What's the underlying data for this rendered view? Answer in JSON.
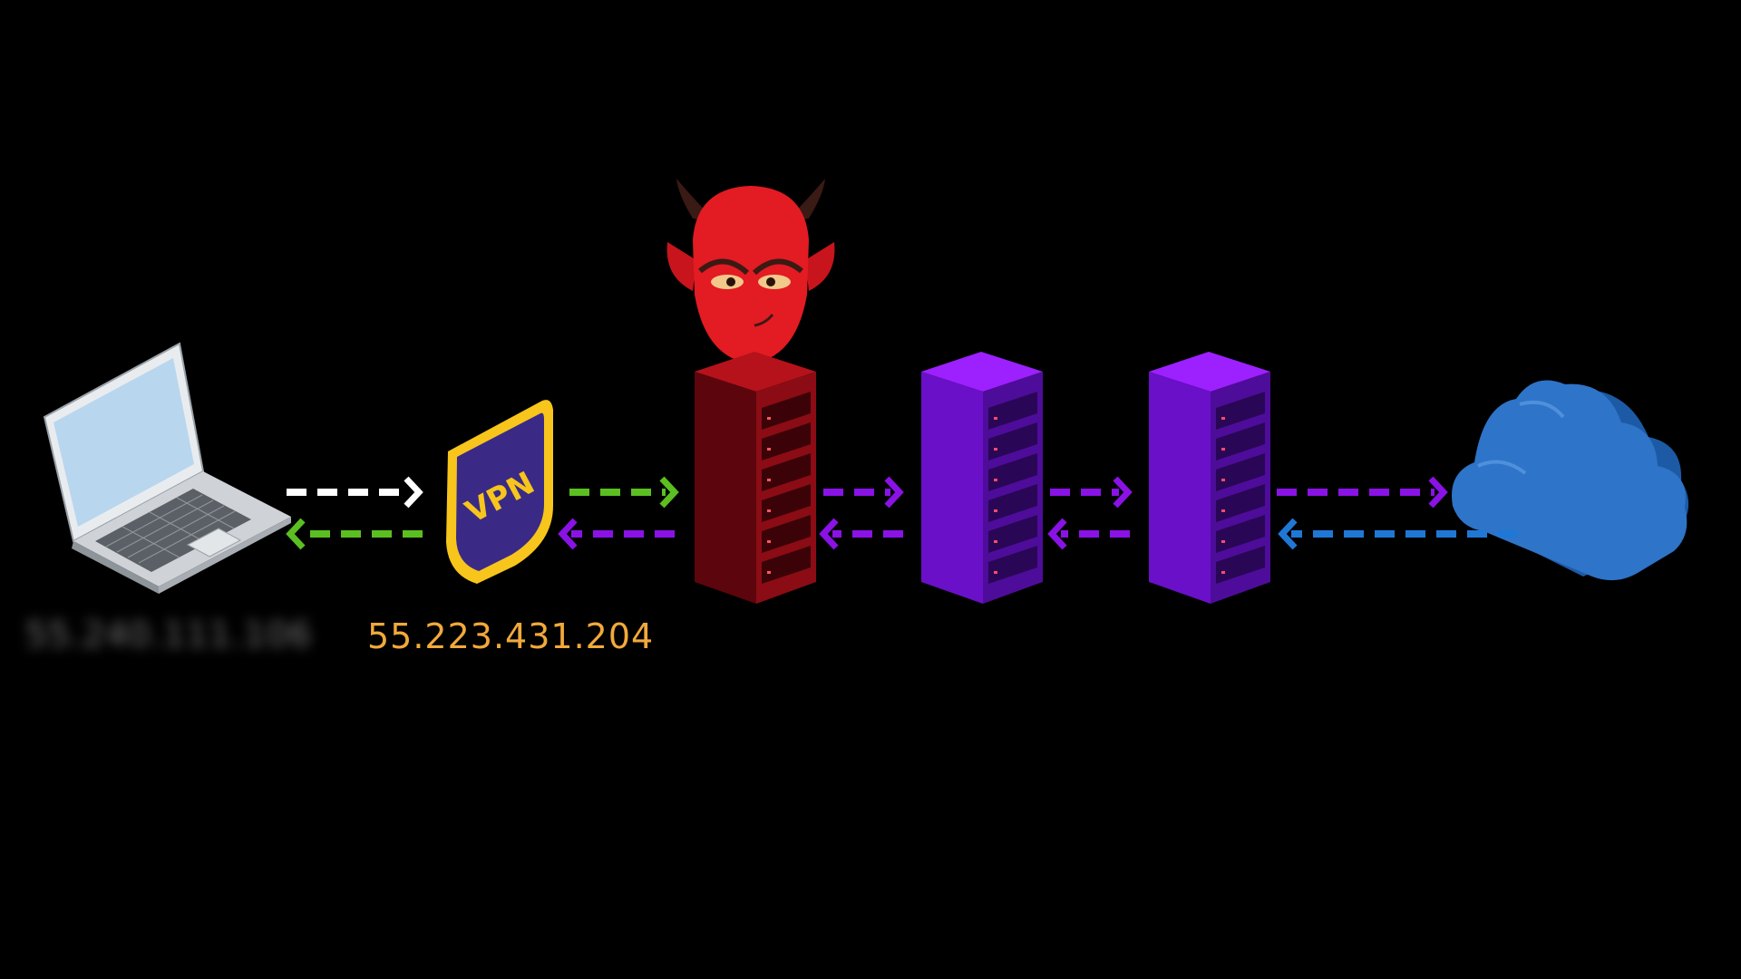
{
  "vpn_badge": {
    "text": "VPN"
  },
  "labels": {
    "client_ip": "55.240.111.106",
    "vpn_ip": "55.223.431.204"
  },
  "colors": {
    "background": "#000000",
    "vpn_ip_text": "#f2a93b",
    "arrow_white": "#ffffff",
    "arrow_green": "#5bbf21",
    "arrow_purple": "#8a12e6",
    "arrow_blue": "#1f78d6",
    "malicious_server": "#8b0c14",
    "relay_server": "#5a10a8",
    "cloud": "#2e74c8",
    "vpn_shield_fill": "#3a2a86",
    "vpn_shield_border": "#f7c51b",
    "devil_face": "#e31b23"
  },
  "icons": [
    "laptop-icon",
    "vpn-shield-icon",
    "devil-icon",
    "server-rack-icon",
    "cloud-icon"
  ]
}
